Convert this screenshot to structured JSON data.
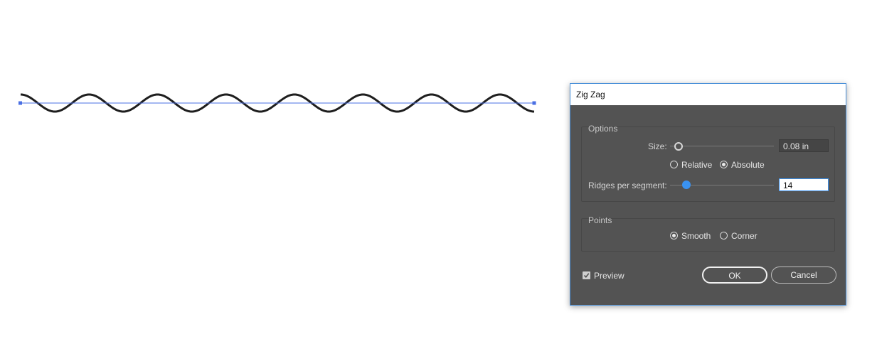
{
  "canvas": {
    "wave": {
      "effect": "zig zag",
      "ridges_per_segment": 14,
      "points": "smooth",
      "stroke_color": "#1e1e1e",
      "path_color": "#4a6fe3"
    }
  },
  "dialog": {
    "title": "Zig Zag",
    "options": {
      "group_label": "Options",
      "size_label": "Size:",
      "size_value": "0.08 in",
      "relative_label": "Relative",
      "absolute_label": "Absolute",
      "size_mode_selected": "Absolute",
      "ridges_label": "Ridges per segment:",
      "ridges_value": "14"
    },
    "points": {
      "group_label": "Points",
      "smooth_label": "Smooth",
      "corner_label": "Corner",
      "selected": "Smooth"
    },
    "preview_label": "Preview",
    "preview_checked": true,
    "ok_label": "OK",
    "cancel_label": "Cancel"
  },
  "colors": {
    "dialog_bg": "#535353",
    "accent": "#3a92f0",
    "dialog_border": "#4a90d9"
  }
}
